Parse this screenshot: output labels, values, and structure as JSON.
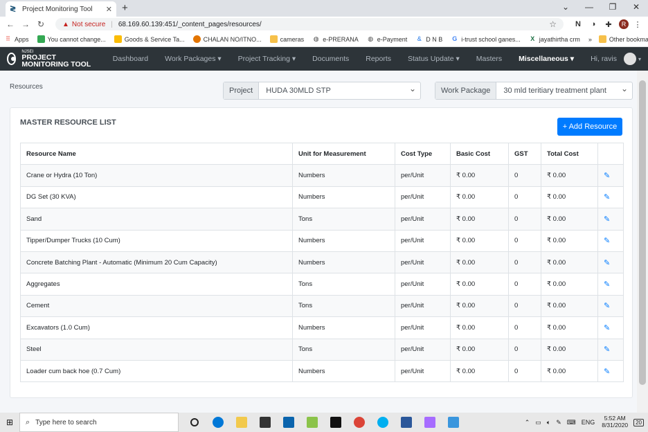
{
  "browser": {
    "tab_title": "Project Monitoring Tool",
    "security_label": "Not secure",
    "url": "68.169.60.139:451/_content_pages/resources/",
    "bookmarks": [
      {
        "label": "Apps",
        "icon": "apps-grid-icon",
        "color": "#ea4335"
      },
      {
        "label": "You cannot change...",
        "icon": "windows-icon",
        "color": "#34a853"
      },
      {
        "label": "Goods & Service Ta...",
        "icon": "document-icon",
        "color": "#fbbc05"
      },
      {
        "label": "CHALAN NO/ITNO...",
        "icon": "bird-icon",
        "color": "#e37400"
      },
      {
        "label": "cameras",
        "icon": "folder-icon",
        "color": "#f6c04a"
      },
      {
        "label": "e-PRERANA",
        "icon": "globe-icon",
        "color": "#444444"
      },
      {
        "label": "e-Payment",
        "icon": "globe-icon",
        "color": "#444444"
      },
      {
        "label": "D N B",
        "icon": "ampersand-icon",
        "color": "#1a73e8"
      },
      {
        "label": "i-trust school ganes...",
        "icon": "google-icon",
        "color": "#4285f4"
      },
      {
        "label": "jayathirtha crm",
        "icon": "excel-x-icon",
        "color": "#1e7145"
      }
    ],
    "more_bookmarks": "»",
    "other_bookmarks": "Other bookmarks",
    "profile_initial": "R"
  },
  "app": {
    "logo_small": "NJSEI",
    "logo_big": "PROJECT MONITORING TOOL",
    "nav": [
      {
        "label": "Dashboard"
      },
      {
        "label": "Work Packages ▾"
      },
      {
        "label": "Project Tracking ▾"
      },
      {
        "label": "Documents"
      },
      {
        "label": "Reports"
      },
      {
        "label": "Status Update ▾"
      },
      {
        "label": "Masters"
      },
      {
        "label": "Miscellaneous ▾"
      }
    ],
    "user_greeting": "Hi, ravis"
  },
  "page": {
    "breadcrumb": "Resources",
    "project_label": "Project",
    "project_value": "HUDA 30MLD STP",
    "work_package_label": "Work Package",
    "work_package_value": "30 mld teritiary treatment plant",
    "card_title": "MASTER RESOURCE LIST",
    "add_button": "+ Add Resource",
    "columns": [
      "Resource Name",
      "Unit for Measurement",
      "Cost Type",
      "Basic Cost",
      "GST",
      "Total Cost"
    ],
    "rows": [
      {
        "name": "Crane or Hydra (10 Ton)",
        "unit": "Numbers",
        "cost_type": "per/Unit",
        "basic": "₹ 0.00",
        "gst": "0",
        "total": "₹ 0.00"
      },
      {
        "name": "DG Set (30 KVA)",
        "unit": "Numbers",
        "cost_type": "per/Unit",
        "basic": "₹ 0.00",
        "gst": "0",
        "total": "₹ 0.00"
      },
      {
        "name": "Sand",
        "unit": "Tons",
        "cost_type": "per/Unit",
        "basic": "₹ 0.00",
        "gst": "0",
        "total": "₹ 0.00"
      },
      {
        "name": "Tipper/Dumper Trucks (10 Cum)",
        "unit": "Numbers",
        "cost_type": "per/Unit",
        "basic": "₹ 0.00",
        "gst": "0",
        "total": "₹ 0.00"
      },
      {
        "name": "Concrete Batching Plant - Automatic (Minimum 20 Cum Capacity)",
        "unit": "Numbers",
        "cost_type": "per/Unit",
        "basic": "₹ 0.00",
        "gst": "0",
        "total": "₹ 0.00"
      },
      {
        "name": "Aggregates",
        "unit": "Tons",
        "cost_type": "per/Unit",
        "basic": "₹ 0.00",
        "gst": "0",
        "total": "₹ 0.00"
      },
      {
        "name": "Cement",
        "unit": "Tons",
        "cost_type": "per/Unit",
        "basic": "₹ 0.00",
        "gst": "0",
        "total": "₹ 0.00"
      },
      {
        "name": "Excavators (1.0 Cum)",
        "unit": "Numbers",
        "cost_type": "per/Unit",
        "basic": "₹ 0.00",
        "gst": "0",
        "total": "₹ 0.00"
      },
      {
        "name": "Steel",
        "unit": "Tons",
        "cost_type": "per/Unit",
        "basic": "₹ 0.00",
        "gst": "0",
        "total": "₹ 0.00"
      },
      {
        "name": "Loader cum back hoe (0.7 Cum)",
        "unit": "Numbers",
        "cost_type": "per/Unit",
        "basic": "₹ 0.00",
        "gst": "0",
        "total": "₹ 0.00"
      }
    ]
  },
  "taskbar": {
    "search_placeholder": "Type here to search",
    "apps": [
      {
        "icon": "cortana-circle-icon",
        "color": "#222222"
      },
      {
        "icon": "edge-icon",
        "color": "#0078d7"
      },
      {
        "icon": "file-explorer-icon",
        "color": "#f2c94c"
      },
      {
        "icon": "store-icon",
        "color": "#333333"
      },
      {
        "icon": "outlook-icon",
        "color": "#0a64ad"
      },
      {
        "icon": "paint-icon",
        "color": "#8bc34a"
      },
      {
        "icon": "terminal-icon",
        "color": "#111111"
      },
      {
        "icon": "chrome-icon",
        "color": "#db4437"
      },
      {
        "icon": "skype-icon",
        "color": "#00aff0"
      },
      {
        "icon": "word-icon",
        "color": "#2b579a"
      },
      {
        "icon": "paint3d-icon",
        "color": "#a66cff"
      },
      {
        "icon": "photos-icon",
        "color": "#3a96dd"
      }
    ],
    "language": "ENG",
    "time": "5:52 AM",
    "date": "8/31/2020",
    "notification_count": "20"
  }
}
